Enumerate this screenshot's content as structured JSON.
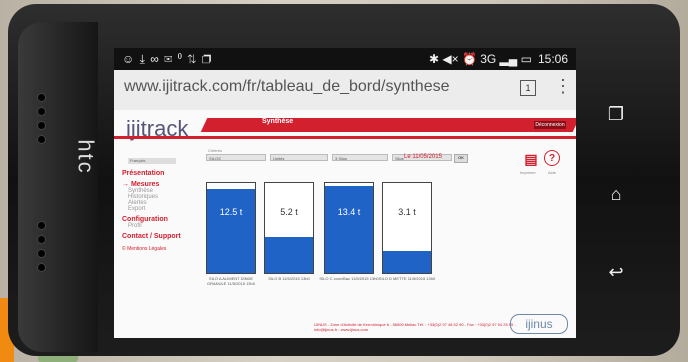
{
  "status_bar": {
    "time": "15:06",
    "left_icons": "☺ ⤓ ∞ ✉ ⁰ ⇅ ❐",
    "right_icons": "✱ ◀× ⏰ 3G ▂▄ ▭"
  },
  "browser": {
    "url": "www.ijitrack.com/fr/tableau_de_bord/synthese",
    "tab_count": "1",
    "menu_icon": "⋮"
  },
  "app": {
    "logo": "ijitrack",
    "header_title": "Synthèse",
    "header_button": "Déconnexion",
    "language": "Français",
    "sidebar": {
      "presentation": "Présentation",
      "mesures": "→ Mesures",
      "mesures_items": [
        "Synthèse",
        "Historiques",
        "Alertes",
        "Export"
      ],
      "configuration": "Configuration",
      "config_items": [
        "Profil"
      ],
      "contact": "Contact / Support",
      "legal": "© Mentions Légales"
    },
    "filters": {
      "label": "Critères",
      "selects": [
        "SILOS",
        "Unités",
        "3 Silos",
        "Silos"
      ],
      "date": "Le 11/05/2015",
      "ok": "OK",
      "print_caption": "Imprimer",
      "help_caption": "Aide"
    },
    "silos": [
      {
        "value": "12.5 t",
        "fill": 0.93,
        "caption": "SILO A ALIMENT DINDE GRANULE 11/5/2015 13h0"
      },
      {
        "value": "5.2 t",
        "fill": 0.4,
        "caption": "SILO B 11/5/2015 13h0"
      },
      {
        "value": "13.4 t",
        "fill": 0.97,
        "caption": "SILO C conv/Baz 11/5/2015 13h0"
      },
      {
        "value": "3.1 t",
        "fill": 0.24,
        "caption": "SILO D METTE 11/5/2015 13h0"
      }
    ],
    "footer": "IJINUS - Zone d'Activité de Kerrohinique 6 - 56500 Mellac  Tél. : +33(0)2 97 48 52 90 - Fax : +33(0)2 97 94 25 59 - info@ijinus.fr - www.ijinus.com",
    "ijinus_logo": "ijinus"
  },
  "device": {
    "brand": "htc",
    "nav": [
      "❐",
      "⌂",
      "↩"
    ]
  },
  "colors": {
    "accent": "#d2202f",
    "fill": "#1f63c6"
  }
}
